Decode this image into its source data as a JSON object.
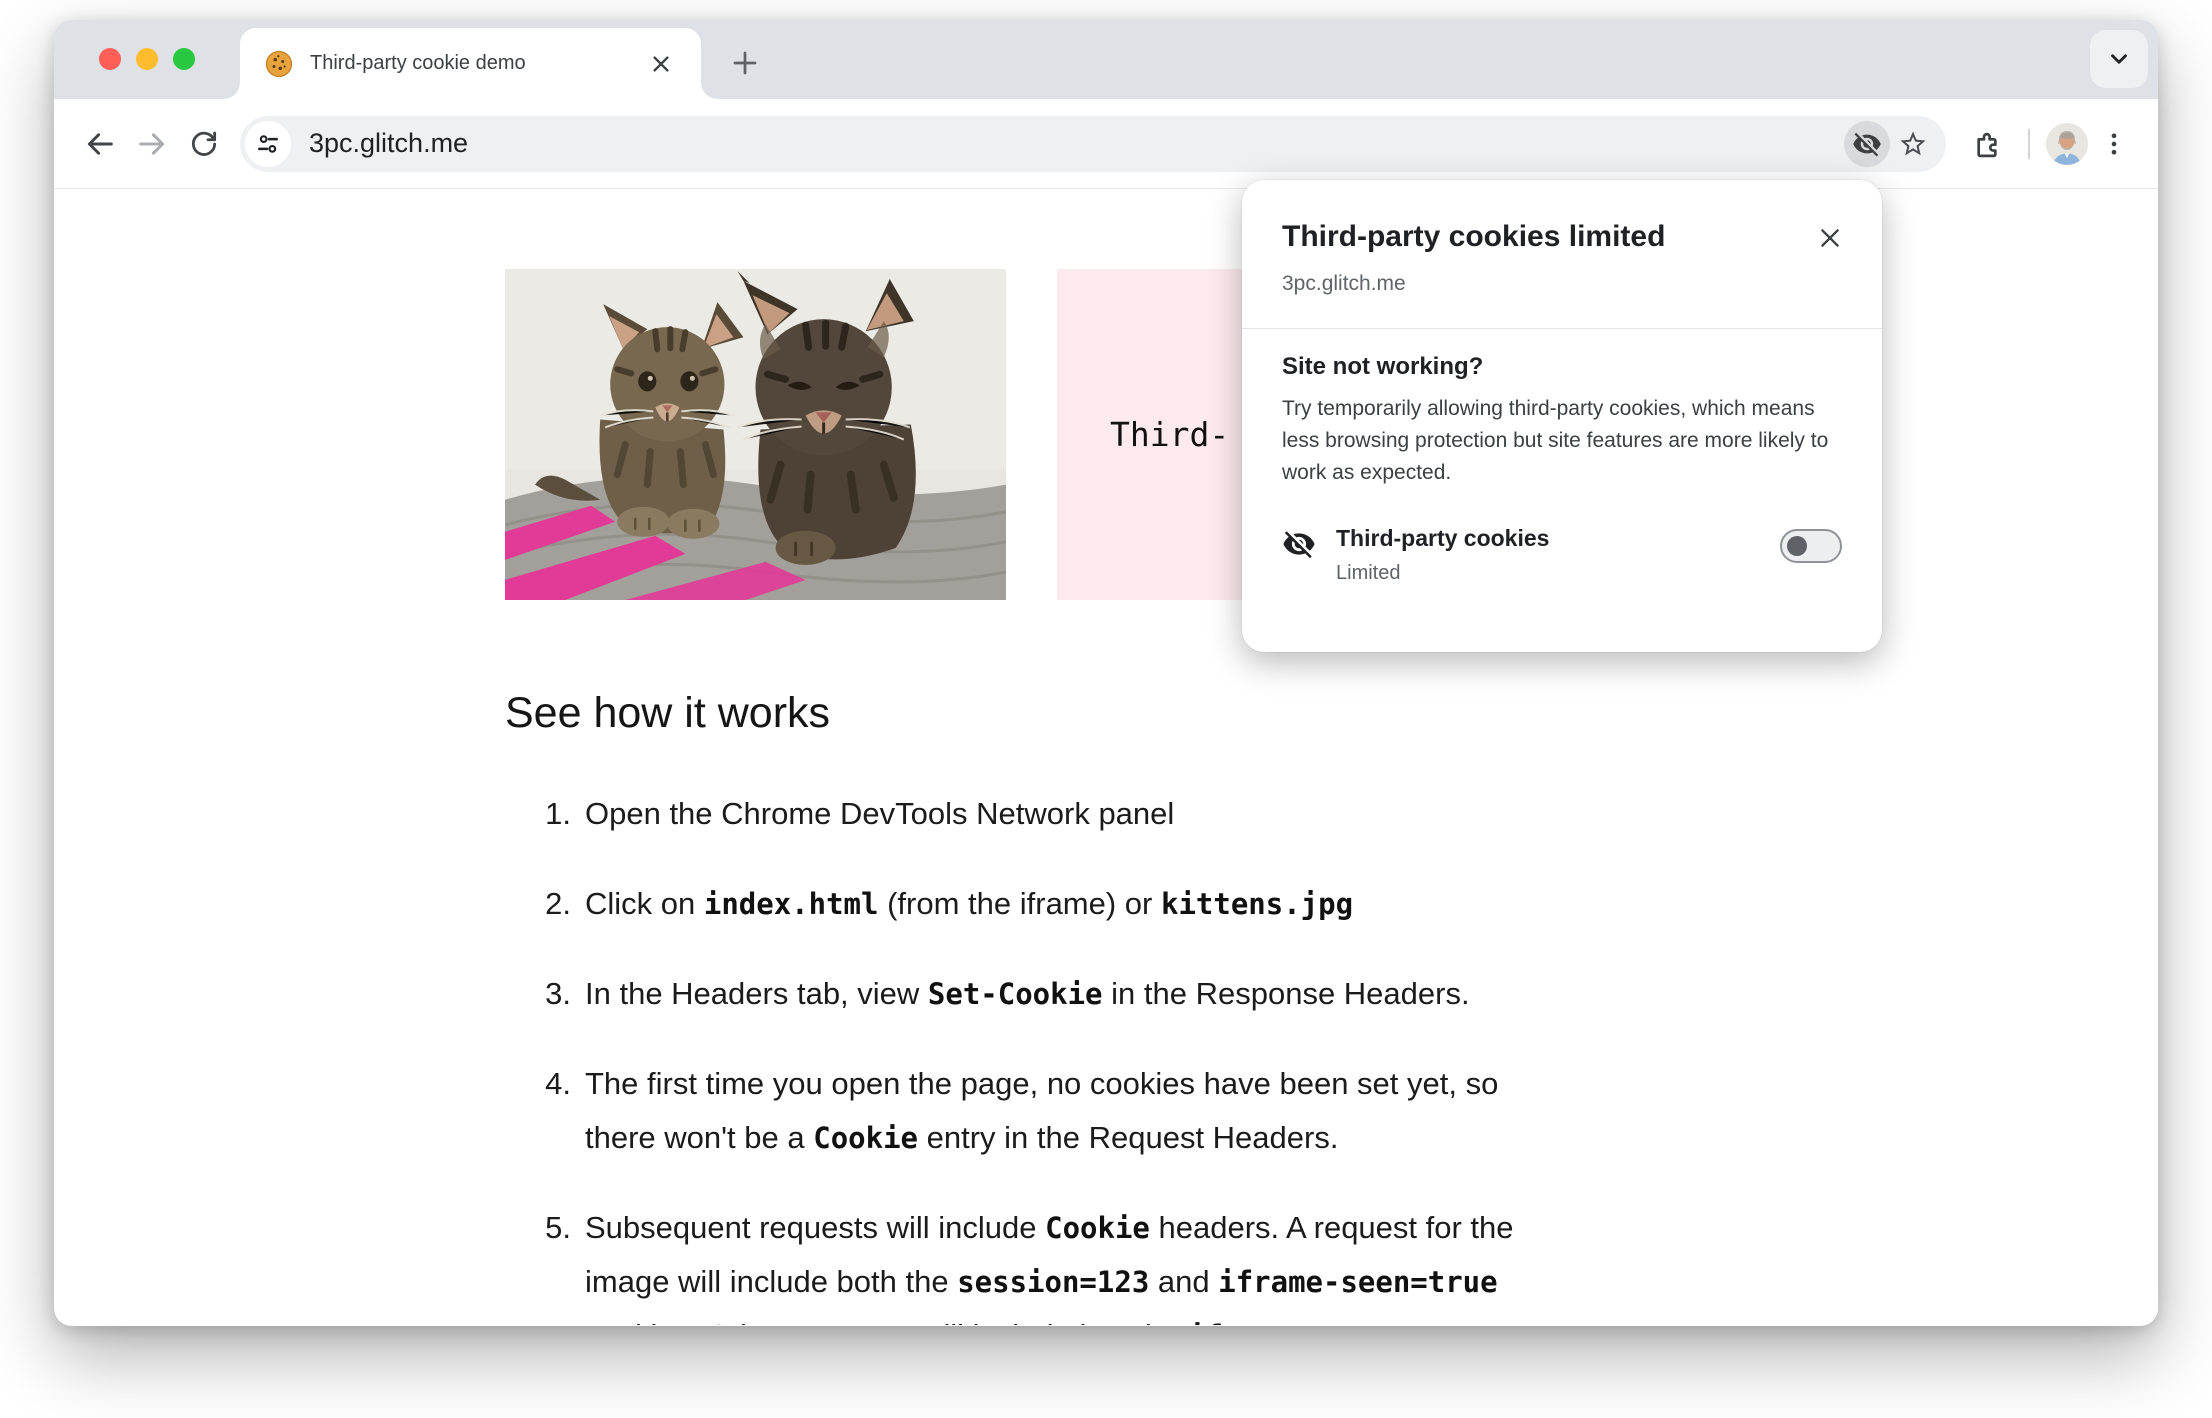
{
  "tab_bar": {
    "tab_title": "Third-party cookie demo"
  },
  "toolbar": {
    "url": "3pc.glitch.me"
  },
  "popup": {
    "title": "Third-party cookies limited",
    "site": "3pc.glitch.me",
    "section_title": "Site not working?",
    "description": "Try temporarily allowing third-party cookies, which means less browsing protection but site features are more likely to work as expected.",
    "toggle_label": "Third-party cookies",
    "toggle_status": "Limited",
    "toggle_state": "off"
  },
  "page": {
    "iframe_visible_text": "Third-",
    "heading": "See how it works",
    "steps": [
      {
        "num": "1.",
        "segments": [
          {
            "text": "Open the Chrome DevTools Network panel"
          }
        ]
      },
      {
        "num": "2.",
        "segments": [
          {
            "text": "Click on "
          },
          {
            "code": "index.html"
          },
          {
            "text": " (from the iframe) or "
          },
          {
            "code": "kittens.jpg"
          }
        ]
      },
      {
        "num": "3.",
        "segments": [
          {
            "text": "In the Headers tab, view "
          },
          {
            "code": "Set-Cookie"
          },
          {
            "text": " in the Response Headers."
          }
        ]
      },
      {
        "num": "4.",
        "segments": [
          {
            "text": "The first time you open the page, no cookies have been set yet, so"
          },
          {
            "br": true
          },
          {
            "text": "there won't be a "
          },
          {
            "code": "Cookie"
          },
          {
            "text": " entry in the Request Headers."
          }
        ]
      },
      {
        "num": "5.",
        "segments": [
          {
            "text": "Subsequent requests will include "
          },
          {
            "code": "Cookie"
          },
          {
            "text": " headers. A request for the"
          },
          {
            "br": true
          },
          {
            "text": "image will include both the "
          },
          {
            "code": "session=123"
          },
          {
            "text": " and "
          },
          {
            "code": "iframe-seen=true"
          },
          {
            "br": true
          },
          {
            "text": "cookies. Other requests will include just the "
          },
          {
            "code": "if"
          }
        ]
      }
    ]
  },
  "colors": {
    "traffic_red": "#ff5f57",
    "traffic_yellow": "#febc2e",
    "traffic_green": "#28c840",
    "tabstrip_bg": "#dee1e6",
    "omnibox_bg": "#eff0f2",
    "iframe_pink": "#fdeaee",
    "icon_gray": "#5f6368",
    "text_dark": "#202124"
  }
}
